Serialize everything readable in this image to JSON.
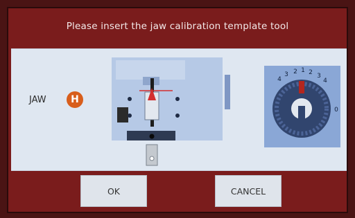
{
  "dialog": {
    "title": "Please insert the jaw calibration template tool"
  },
  "jaw": {
    "label": "JAW",
    "badge_letter": "H",
    "badge_color": "#d85e1c"
  },
  "dial": {
    "scale_left": [
      "4",
      "3",
      "2",
      "1"
    ],
    "scale_right": [
      "1",
      "2",
      "3",
      "4"
    ],
    "zero_label": "0",
    "pointer_color": "#b3261e"
  },
  "buttons": {
    "ok": "OK",
    "cancel": "CANCEL"
  },
  "colors": {
    "frame": "#7a1c1c",
    "panel": "#dfe7f1",
    "diagram_body": "#b6c9e6",
    "dial_body": "#8aa7d6",
    "indicator_red": "#d32f2f"
  }
}
